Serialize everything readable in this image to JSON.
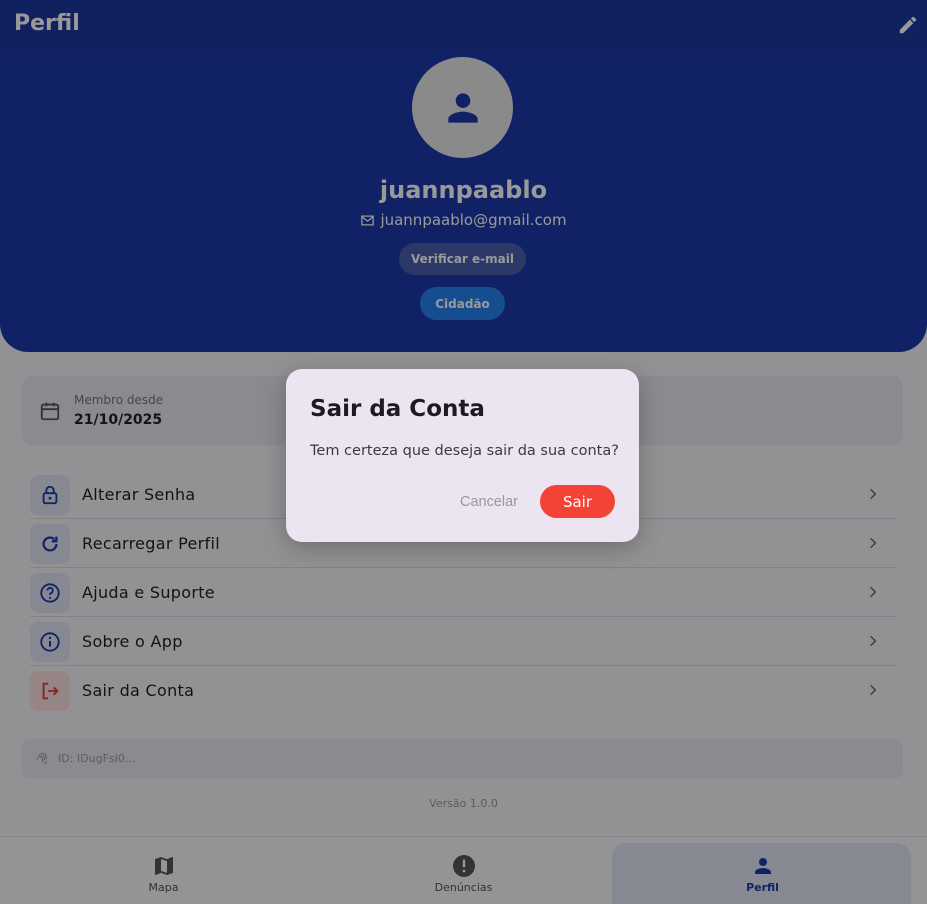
{
  "appbar": {
    "title": "Perfil",
    "edit_icon": "pencil-icon"
  },
  "profile": {
    "username": "juannpaablo",
    "email": "juannpaablo@gmail.com",
    "verify_label": "Verificar e-mail",
    "role_label": "Cidadão"
  },
  "member": {
    "label": "Membro desde",
    "date": "21/10/2025"
  },
  "menu": {
    "items": [
      {
        "label": "Alterar Senha",
        "icon": "lock-icon"
      },
      {
        "label": "Recarregar Perfil",
        "icon": "refresh-icon"
      },
      {
        "label": "Ajuda e Suporte",
        "icon": "help-icon"
      },
      {
        "label": "Sobre o App",
        "icon": "info-icon"
      },
      {
        "label": "Sair da Conta",
        "icon": "logout-icon"
      }
    ]
  },
  "id_card": {
    "text": "ID: IDugFsI0..."
  },
  "version": "Versão 1.0.0",
  "bottom_nav": {
    "items": [
      {
        "label": "Mapa",
        "icon": "map-icon"
      },
      {
        "label": "Denúncias",
        "icon": "alert-icon"
      },
      {
        "label": "Perfil",
        "icon": "person-icon"
      }
    ],
    "active": "Perfil"
  },
  "dialog": {
    "title": "Sair da Conta",
    "message": "Tem certeza que deseja sair da sua conta?",
    "cancel_label": "Cancelar",
    "confirm_label": "Sair"
  },
  "colors": {
    "primary": "#1c3aa9",
    "accent": "#2383ee",
    "danger": "#f44336"
  }
}
